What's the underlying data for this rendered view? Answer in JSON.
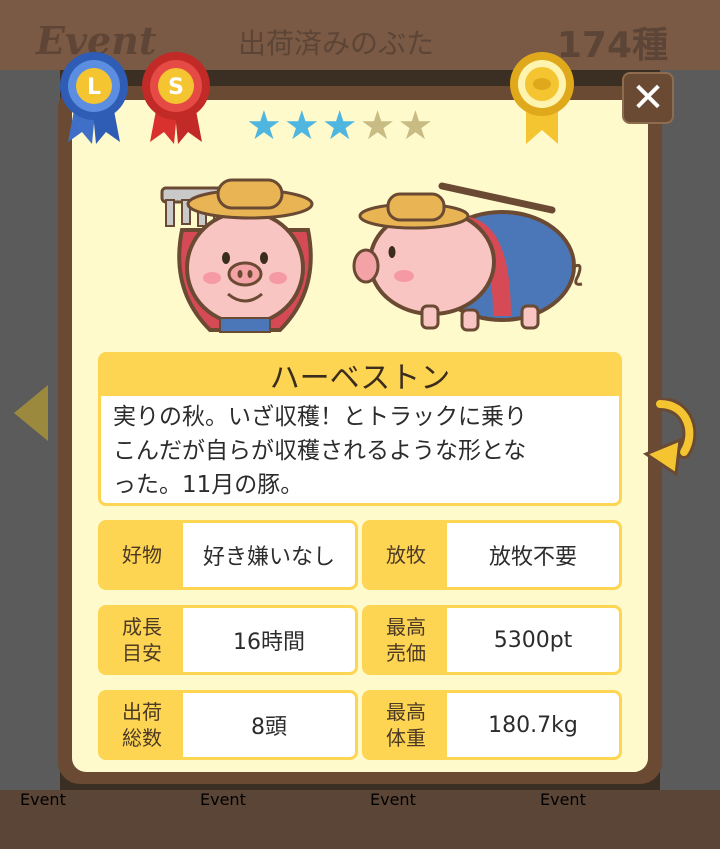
{
  "background": {
    "event_logo": "Event",
    "header_title": "出荷済みのぶた",
    "header_count": "174種",
    "footer_labels": [
      "Event",
      "Event",
      "Event",
      "Event"
    ]
  },
  "ribbons": {
    "left_1": "L",
    "left_2": "S"
  },
  "rating": {
    "filled": 3,
    "total": 5
  },
  "pig": {
    "name": "ハーベストン",
    "description_lines": [
      "実りの秋。いざ収穫！とトラックに乗り",
      "こんだが自らが収穫されるような形とな",
      "った。11月の豚。"
    ]
  },
  "stats": {
    "favorite": {
      "label": "好物",
      "value": "好き嫌いなし"
    },
    "grazing": {
      "label": "放牧",
      "value": "放牧不要"
    },
    "growth": {
      "label_line1": "成長",
      "label_line2": "目安",
      "value": "16時間"
    },
    "max_price": {
      "label_line1": "最高",
      "label_line2": "売価",
      "value": "5300pt"
    },
    "shipped": {
      "label_line1": "出荷",
      "label_line2": "総数",
      "value": "8頭"
    },
    "max_weight": {
      "label_line1": "最高",
      "label_line2": "体重",
      "value": "180.7kg"
    }
  },
  "colors": {
    "panel_bg": "#fffacc",
    "accent_yellow": "#fdd552",
    "frame_brown": "#6b4a33",
    "star_on": "#4fb6e0",
    "star_off": "#c9bb84"
  }
}
